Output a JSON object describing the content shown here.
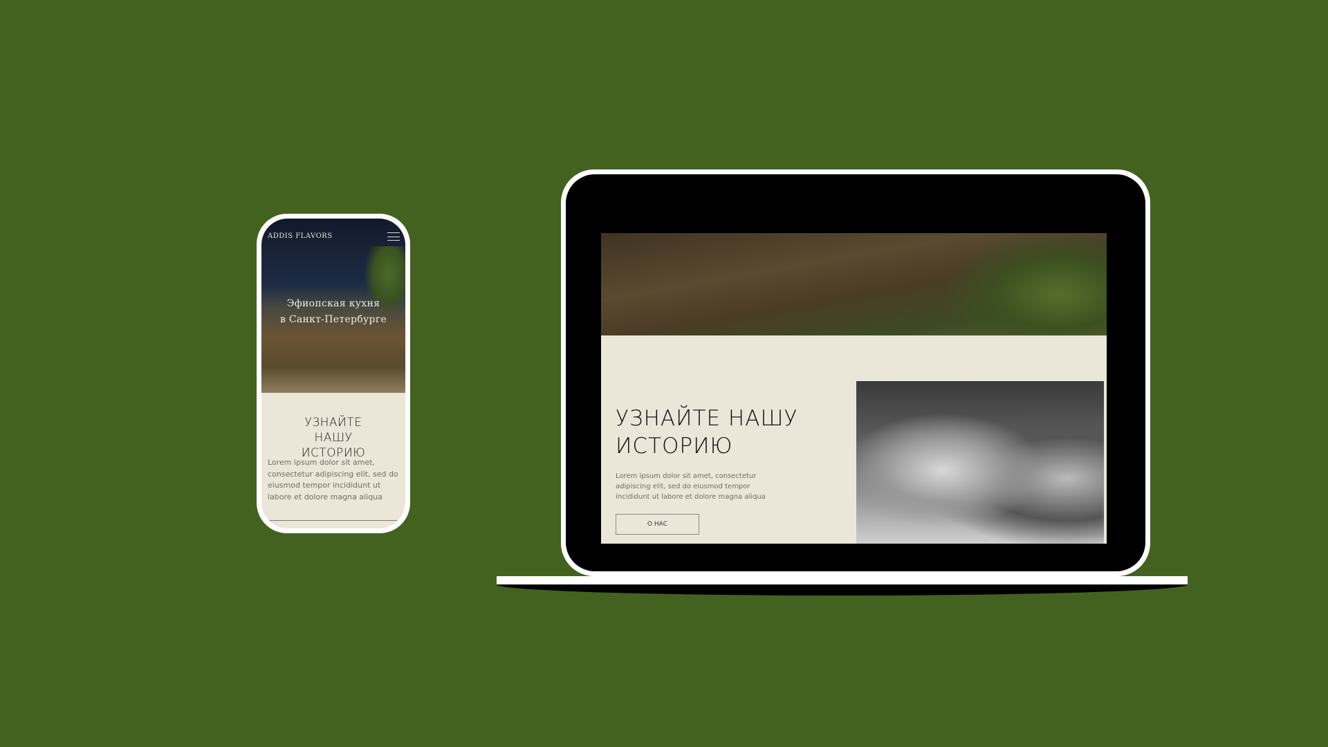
{
  "background_color": "#44621f",
  "phone": {
    "logo": "ADDIS FLAVORS",
    "menu_icon": "hamburger-icon",
    "hero_title_line1": "Эфиопская кухня",
    "hero_title_line2": "в Санкт-Петербурге",
    "heading": "УЗНАЙТЕ НАШУ ИСТОРИЮ",
    "paragraph": "Lorem ipsum dolor sit amet, consectetur adipiscing elit, sed do eiusmod tempor incididunt ut labore et dolore magna aliqua"
  },
  "laptop": {
    "heading": "УЗНАЙТЕ НАШУ ИСТОРИЮ",
    "paragraph": "Lorem ipsum dolor sit amet, consectetur adipiscing elit, sed do eiusmod tempor incididunt ut labore et dolore magna aliqua",
    "button_label": "О НАС"
  },
  "colors": {
    "cream": "#ebe7d8",
    "text_dark": "#111111"
  }
}
